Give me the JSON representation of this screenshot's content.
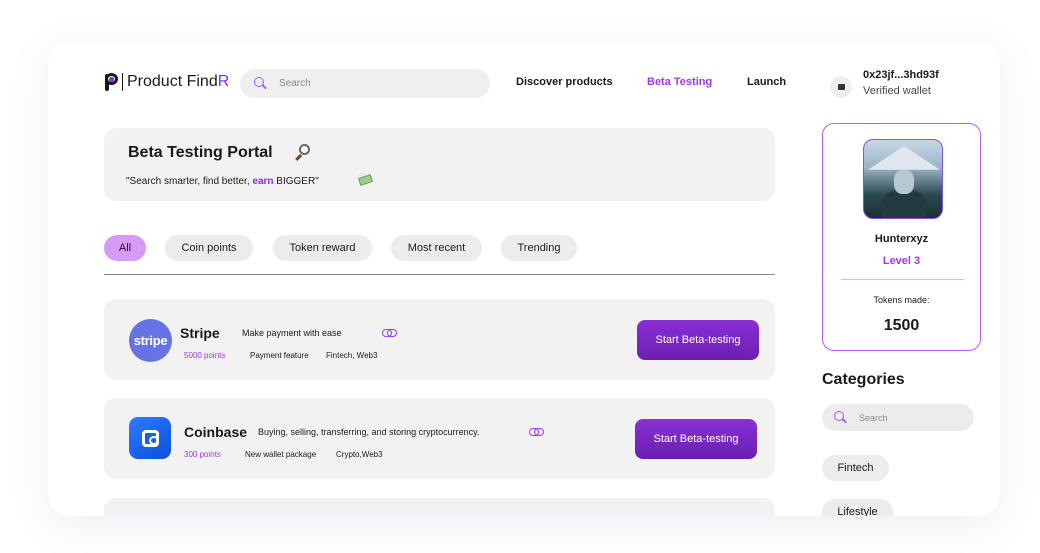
{
  "header": {
    "logo_text": "Product Find",
    "logo_accent": "R",
    "search_placeholder": "Search",
    "nav": [
      "Discover products",
      "Beta Testing",
      "Launch"
    ],
    "active_nav": "Beta Testing",
    "wallet_address": "0x23jf...3hd93f",
    "wallet_status": "Verified wallet"
  },
  "portal": {
    "title": "Beta Testing Portal",
    "subtitle_before": "\"Search smarter, find better, ",
    "subtitle_accent": "earn",
    "subtitle_after": " BIGGER\""
  },
  "filters": [
    "All",
    "Coin points",
    "Token reward",
    "Most recent",
    "Trending"
  ],
  "active_filter": "All",
  "products": [
    {
      "name": "Stripe",
      "logo_text": "stripe",
      "description": "Make payment with ease",
      "points": "5000 points",
      "feature": "Payment feature",
      "tags": "Fintech, Web3",
      "button": "Start Beta-testing"
    },
    {
      "name": "Coinbase",
      "description": "Buying, selling, transferring, and storing cryptocurrency.",
      "points": "300 points",
      "feature": "New wallet package",
      "tags": "Crypto,Web3",
      "button": "Start Beta-testing"
    }
  ],
  "profile": {
    "username": "Hunterxyz",
    "level": "Level 3",
    "tokens_label": "Tokens made:",
    "tokens_value": "1500"
  },
  "categories": {
    "title": "Categories",
    "search_placeholder": "Search",
    "items": [
      "Fintech",
      "Lifestyle"
    ]
  },
  "colors": {
    "accent": "#a436f0",
    "active_chip": "#d79bf7",
    "button": "#7a26c4",
    "stripe": "#6772e5",
    "coinbase": "#1a5fe8"
  }
}
